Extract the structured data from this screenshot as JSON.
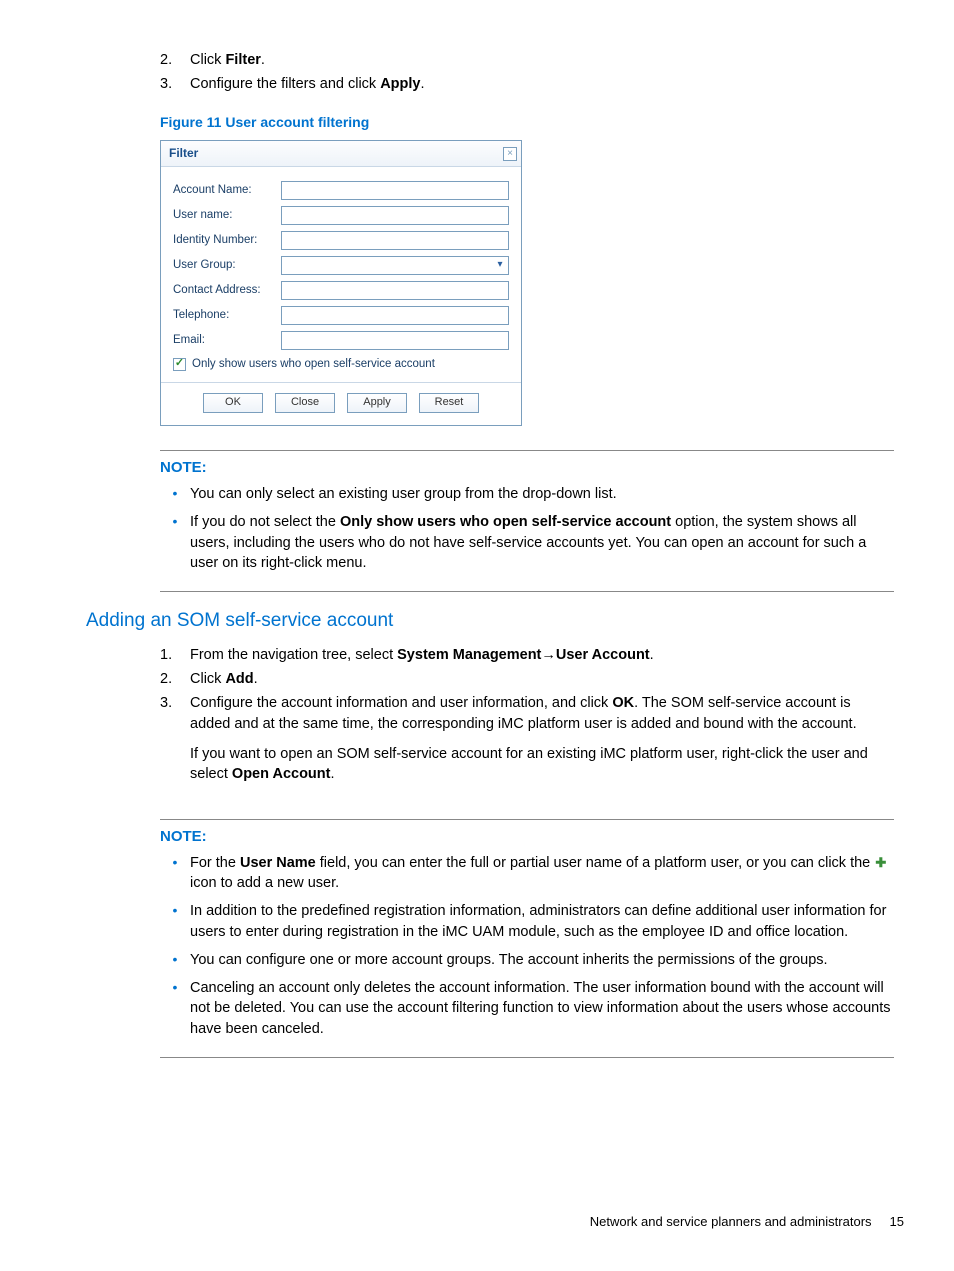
{
  "steps_top": [
    {
      "num": "2.",
      "prefix": "Click ",
      "bold": "Filter",
      "suffix": "."
    },
    {
      "num": "3.",
      "prefix": "Configure the filters and click ",
      "bold": "Apply",
      "suffix": "."
    }
  ],
  "figure_caption": "Figure 11 User account filtering",
  "dialog": {
    "title": "Filter",
    "fields": {
      "account_name": "Account Name:",
      "user_name": "User name:",
      "identity_number": "Identity Number:",
      "user_group": "User Group:",
      "contact_address": "Contact Address:",
      "telephone": "Telephone:",
      "email": "Email:"
    },
    "checkbox_label": "Only show users who open self-service account",
    "buttons": {
      "ok": "OK",
      "close": "Close",
      "apply": "Apply",
      "reset": "Reset"
    }
  },
  "note1": {
    "label": "NOTE:",
    "items": [
      "You can only select an existing user group from the drop-down list.",
      {
        "pre": "If you do not select the ",
        "bold": "Only show users who open self-service account",
        "post": " option, the system shows all users, including the users who do not have self-service accounts yet. You can open an account for such a user on its right-click menu."
      }
    ]
  },
  "section_heading": "Adding an SOM self-service account",
  "steps_add": {
    "s1": {
      "num": "1.",
      "pre": "From the navigation tree, select ",
      "b1": "System Management",
      "arrow": "→",
      "b2": "User Account",
      "post": "."
    },
    "s2": {
      "num": "2.",
      "pre": "Click ",
      "b1": "Add",
      "post": "."
    },
    "s3": {
      "num": "3.",
      "pre": "Configure the account information and user information, and click ",
      "b1": "OK",
      "post": ". The SOM self-service account is added and at the same time, the corresponding iMC platform user is added and bound with the account."
    },
    "s3_p2": {
      "pre": "If you want to open an SOM self-service account for an existing iMC platform user, right-click the user and select ",
      "b1": "Open Account",
      "post": "."
    }
  },
  "note2": {
    "label": "NOTE:",
    "i1": {
      "pre": "For the ",
      "b": "User Name",
      "mid": " field, you can enter the full or partial user name of a platform user, or you can click the ",
      "post": " icon to add a new user."
    },
    "i2": "In addition to the predefined registration information, administrators can define additional user information for users to enter during registration in the iMC UAM module, such as the employee ID and office location.",
    "i3": "You can configure one or more account groups. The account inherits the permissions of the groups.",
    "i4": "Canceling an account only deletes the account information. The user information bound with the account will not be deleted. You can use the account filtering function to view information about the users whose accounts have been canceled."
  },
  "footer": {
    "text": "Network and service planners and administrators",
    "page": "15"
  }
}
